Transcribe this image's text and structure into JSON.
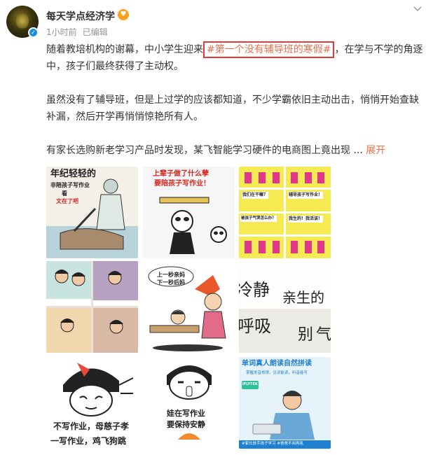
{
  "post": {
    "author": "每天学点经济学",
    "time": "1小时前",
    "edited": "已编辑",
    "p1_before": "随着教培机构的谢幕，中小学生迎来",
    "hashtag": "#第一个没有辅导班的寒假#",
    "p1_after": "，在学与不学的角逐中，孩子们最终获得了主动权。",
    "p2": "虽然没有了辅导班，但是上过学的应该都知道，不少学霸依旧主动出击，悄悄开始查缺补漏，然后开学再悄悄惊艳所有人。",
    "p3": "有家长选购新老学习产品时发现，某飞智能学习硬件的电商图上竟出现",
    "ellipsis": "...",
    "expand": "展开"
  },
  "images": {
    "img1": {
      "line1": "年纪轻轻的",
      "line2": "非陪孩子写作业",
      "line3": "看",
      "line4": "文在了吧"
    },
    "img2": {
      "line1": "上辈子做了什么孽",
      "line2": "要陪孩子写作业！"
    },
    "img3": {
      "q1": "我们在干嘛？",
      "q2": "辅导孩子写作业！",
      "q3": "被孩子气哭怎么办？",
      "q4": "我生的！我活该！"
    },
    "img4": {},
    "img5": {
      "line1": "上一秒亲妈",
      "line2": "下一秒后妈"
    },
    "img6": {
      "w1": "冷静",
      "w2": "亲生的",
      "w3": "呼吸",
      "w4": "别",
      "w5": "气"
    },
    "img7": {
      "line1": "不写作业，母慈子孝",
      "line2": "一写作业，鸡飞狗跳"
    },
    "img8": {
      "line1": "娃在写作业",
      "line2": "要保持安静"
    },
    "img9": {
      "title": "单词真人朗读自然拼读",
      "sub": "掌握发音规律，见词能读，听音能写",
      "brand": "iFLYTEK",
      "footer": "#家长放手孩子学习 #爸爸不用再吼"
    }
  },
  "colors": {
    "link": "#eb7350",
    "highlight_border": "#e03a3a",
    "verified": "#1d8fe0"
  }
}
